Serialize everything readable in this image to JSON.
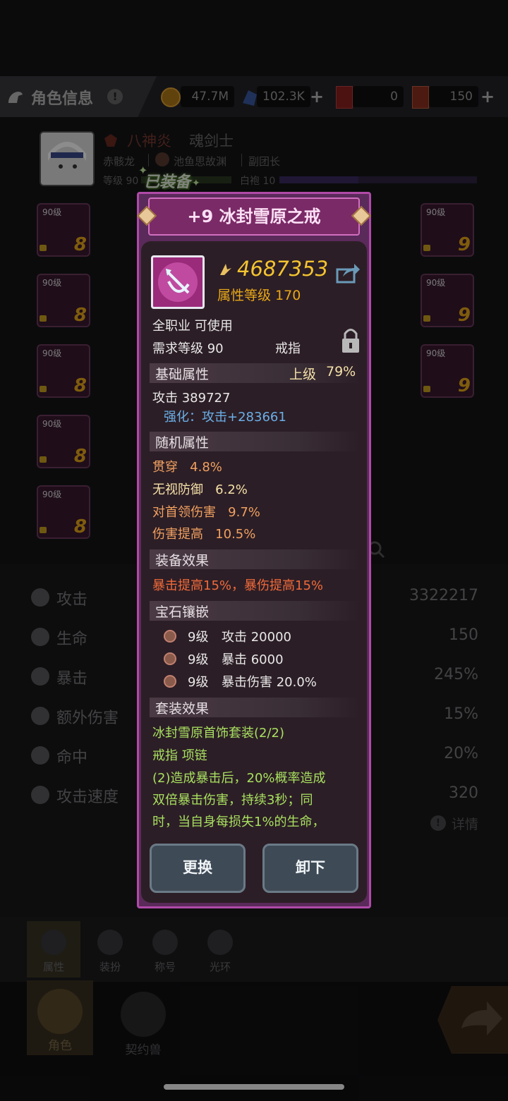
{
  "topbar": {
    "title": "角色信息",
    "gold": "47.7M",
    "crystal": "102.3K",
    "ticket_a": "0",
    "ticket_b": "150"
  },
  "hero": {
    "name": "八神炎",
    "class": "魂剑士",
    "guild_line_left": "赤骸龙",
    "guild": "池鱼思故渊",
    "guild_role": "副团长",
    "level_text": "等级 90",
    "robe_text": "白袍 10",
    "equipped_badge": "已装备"
  },
  "slots_left": [
    {
      "level": "90级",
      "stars": "8"
    },
    {
      "level": "90级",
      "stars": "8"
    },
    {
      "level": "90级",
      "stars": "8"
    },
    {
      "level": "90级",
      "stars": "8"
    },
    {
      "level": "90级",
      "stars": "8"
    }
  ],
  "slots_right": [
    {
      "level": "90级",
      "stars": "9"
    },
    {
      "level": "90级",
      "stars": "9"
    },
    {
      "level": "90级",
      "stars": "9"
    }
  ],
  "stats": [
    {
      "name": "攻击",
      "value": "3322217"
    },
    {
      "name": "生命",
      "value": "150"
    },
    {
      "name": "暴击",
      "value": "245%"
    },
    {
      "name": "额外伤害",
      "value": "15%"
    },
    {
      "name": "命中",
      "value": "20%"
    },
    {
      "name": "攻击速度",
      "value": "320"
    }
  ],
  "detail_link": "详情",
  "tabs": {
    "attr": "属性",
    "dress": "装扮",
    "title": "称号",
    "aura": "光环"
  },
  "nav": {
    "role": "角色",
    "pet": "契约兽"
  },
  "item": {
    "title": "+9 冰封雪原之戒",
    "power": "4687353",
    "attr_level": "属性等级 170",
    "usable": "全职业 可使用",
    "req_level": "需求等级 90",
    "type": "戒指",
    "base_section": "基础属性",
    "grade": "上级",
    "grade_pct": "79%",
    "attack": "攻击 389727",
    "enhance": "强化：攻击+283661",
    "random_section": "随机属性",
    "random": [
      {
        "name": "贯穿",
        "value": "4.8%",
        "color": "#f0a060"
      },
      {
        "name": "无视防御",
        "value": "6.2%",
        "color": "#f4e0a8"
      },
      {
        "name": "对首领伤害",
        "value": "9.7%",
        "color": "#f0a060"
      },
      {
        "name": "伤害提高",
        "value": "10.5%",
        "color": "#f0a060"
      }
    ],
    "effect_section": "装备效果",
    "effect": "暴击提高15%，暴伤提高15%",
    "gem_section": "宝石镶嵌",
    "gems": [
      {
        "level": "9级",
        "stat": "攻击 20000"
      },
      {
        "level": "9级",
        "stat": "暴击 6000"
      },
      {
        "level": "9级",
        "stat": "暴击伤害 20.0%"
      }
    ],
    "set_section": "套装效果",
    "set_name": "冰封雪原首饰套装(2/2)",
    "set_parts": "戒指 项链",
    "set_desc_1": "(2)造成暴击后，20%概率造成",
    "set_desc_2": "双倍暴击伤害，持续3秒；同",
    "set_desc_3": "时，当自身每损失1%的生命，",
    "btn_replace": "更换",
    "btn_unequip": "卸下"
  },
  "colors": {
    "accent": "#b04aa8",
    "gold": "#f4c430",
    "green": "#a8e060",
    "orange": "#f06a3a",
    "blue": "#6ab0e8"
  }
}
